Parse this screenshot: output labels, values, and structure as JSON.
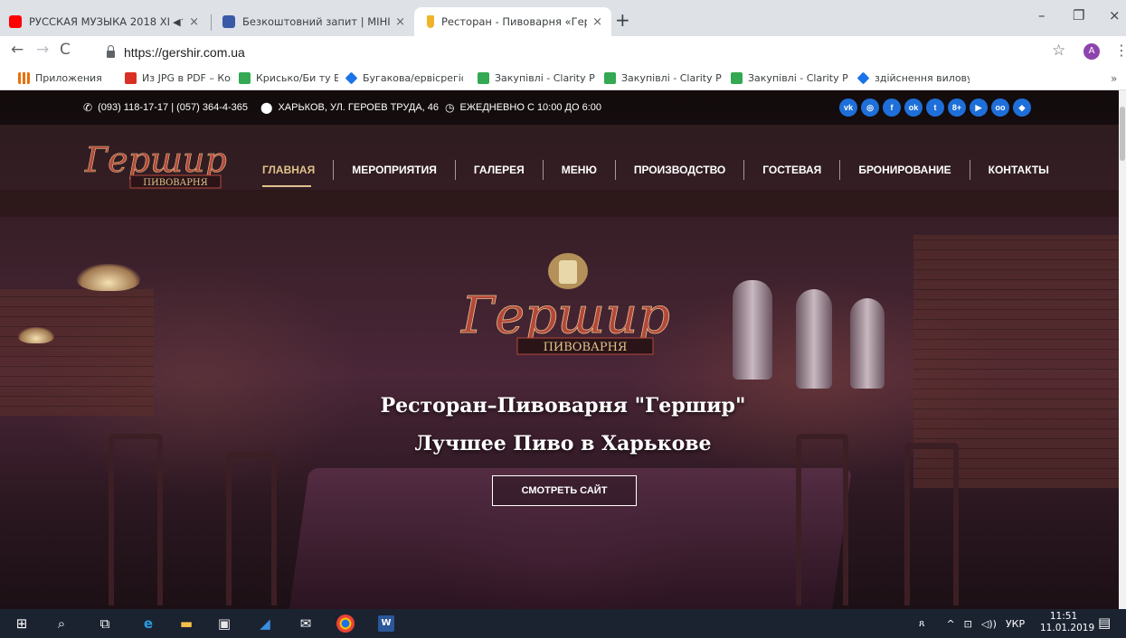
{
  "browser": {
    "tabs": [
      {
        "title": "РУССКАЯ МУЗЫКА 2018 ХИ",
        "icon": "youtube-icon",
        "color": "#ff0000"
      },
      {
        "title": "Безкоштовний запит | МІНІСТЕР",
        "icon": "ministry-icon",
        "color": "#3a5aa8"
      },
      {
        "title": "Ресторан - Пивоварня «Гершир",
        "icon": "beer-icon",
        "color": "#f0b429"
      }
    ],
    "new_tab": "+",
    "window_controls": {
      "minimize": "–",
      "restore": "❐",
      "close": "×"
    },
    "url": "https://gershir.com.ua",
    "profile_initial": "A",
    "bookmarks": [
      {
        "label": "Приложения",
        "icon": "apps-icon",
        "color": "#e8710a"
      },
      {
        "label": "Из JPG в PDF – Конв",
        "icon": "pdf-icon",
        "color": "#d93025"
      },
      {
        "label": "Крисько/Би ту Би",
        "icon": "sheet-icon",
        "color": "#34a853"
      },
      {
        "label": "Бугакова/ервісрегіо",
        "icon": "diamond-icon",
        "color": "#1a73e8"
      },
      {
        "label": "Закупівлі - Clarity Pr",
        "icon": "sheet-icon",
        "color": "#34a853"
      },
      {
        "label": "Закупівлі - Clarity Pr",
        "icon": "sheet-icon",
        "color": "#34a853"
      },
      {
        "label": "Закупівлі - Clarity Pr",
        "icon": "sheet-icon",
        "color": "#34a853"
      },
      {
        "label": "здійснення вилову",
        "icon": "diamond-icon",
        "color": "#1a73e8"
      }
    ],
    "bookmarks_more": "»"
  },
  "site": {
    "phone": "(093) 118-17-17 | (057) 364-4-365",
    "address": "ХАРЬКОВ, УЛ. ГЕРОЕВ ТРУДА, 46",
    "hours": "ЕЖЕДНЕВНО С 10:00 ДО 6:00",
    "social": [
      {
        "label": "vk",
        "icon": "vk-icon"
      },
      {
        "label": "◎",
        "icon": "instagram-icon"
      },
      {
        "label": "f",
        "icon": "facebook-icon"
      },
      {
        "label": "ok",
        "icon": "odnoklassniki-icon"
      },
      {
        "label": "t",
        "icon": "twitter-icon"
      },
      {
        "label": "8+",
        "icon": "google-plus-icon"
      },
      {
        "label": "▶",
        "icon": "youtube-icon"
      },
      {
        "label": "oo",
        "icon": "tripadvisor-icon"
      },
      {
        "label": "◆",
        "icon": "foursquare-icon"
      }
    ],
    "logo_text": "Гершир",
    "logo_sub": "ПИВОВАРНЯ",
    "nav": [
      "ГЛАВНАЯ",
      "МЕРОПРИЯТИЯ",
      "ГАЛЕРЕЯ",
      "МЕНЮ",
      "ПРОИЗВОДСТВО",
      "ГОСТЕВАЯ",
      "БРОНИРОВАНИЕ",
      "КОНТАКТЫ"
    ],
    "hero_title": "Ресторан–Пивоварня \"Гершир\"",
    "hero_subtitle": "Лучшее Пиво в Харькове",
    "cta": "СМОТРЕТЬ САЙТ",
    "accent": "#e0c28a"
  },
  "taskbar": {
    "tray": {
      "people": "ጸ",
      "up": "^",
      "network": "⊡",
      "volume": "◁))",
      "lang": "УКР"
    },
    "time": "11:51",
    "date": "11.01.2019"
  }
}
